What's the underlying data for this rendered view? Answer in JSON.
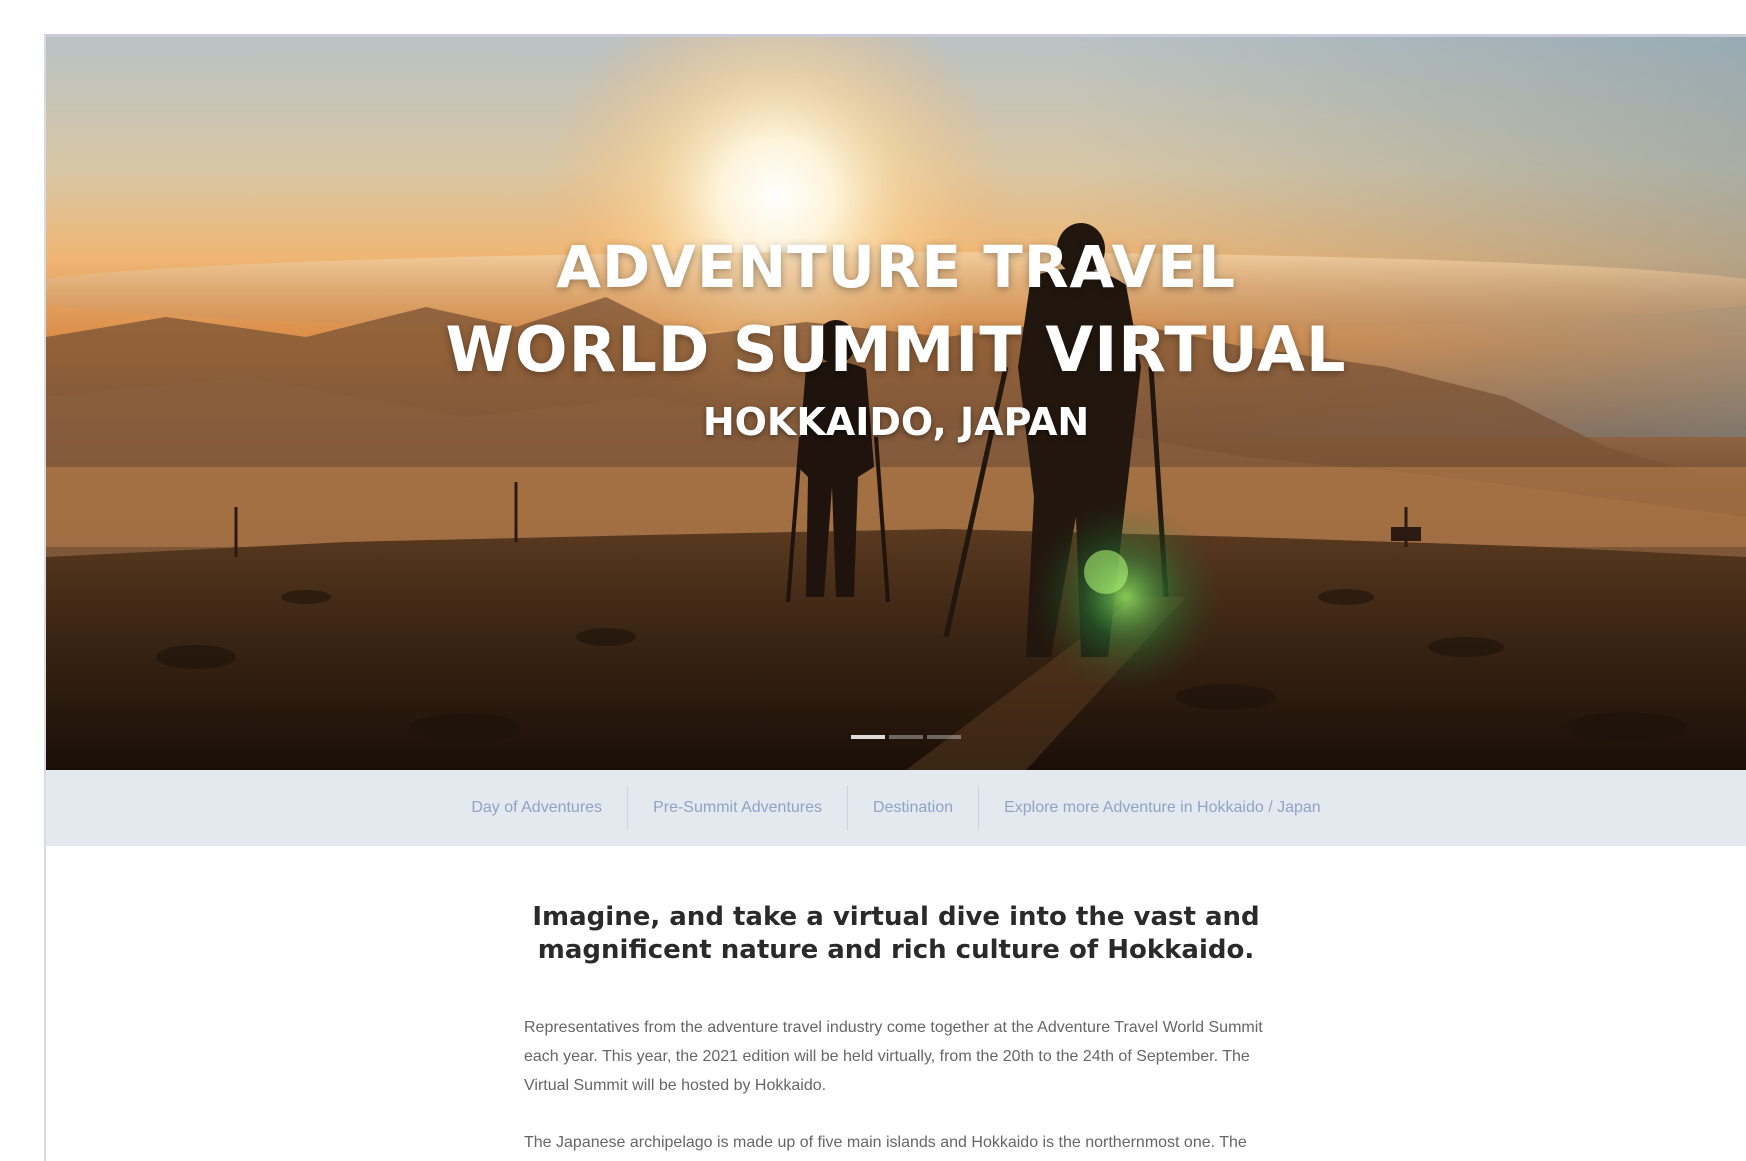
{
  "hero": {
    "title_line1": "ADVENTURE TRAVEL",
    "title_line2": "WORLD SUMMIT VIRTUAL",
    "subtitle": "HOKKAIDO, JAPAN",
    "slides": [
      {
        "active": true
      },
      {
        "active": false
      },
      {
        "active": false
      }
    ]
  },
  "subnav": {
    "items": [
      {
        "label": "Day of Adventures"
      },
      {
        "label": "Pre-Summit Adventures"
      },
      {
        "label": "Destination"
      },
      {
        "label": "Explore more Adventure in Hokkaido / Japan"
      }
    ]
  },
  "content": {
    "headline": "Imagine, and take a virtual dive into the vast and magnificent nature and rich culture of Hokkaido.",
    "paragraph1": "Representatives from the adventure travel industry come together at the Adventure Travel World Summit each year. This year, the 2021 edition will be held virtually, from the 20th to the 24th of September. The Virtual Summit will be hosted by Hokkaido.",
    "paragraph2": "The Japanese archipelago is made up of five main islands and Hokkaido is the northernmost one. The region has the perfect combination of the three elements"
  },
  "colors": {
    "nav_bg": "#e4e8ef",
    "nav_text": "#8fa4c4",
    "headline": "#2a2a2a",
    "body_text": "#666666"
  }
}
